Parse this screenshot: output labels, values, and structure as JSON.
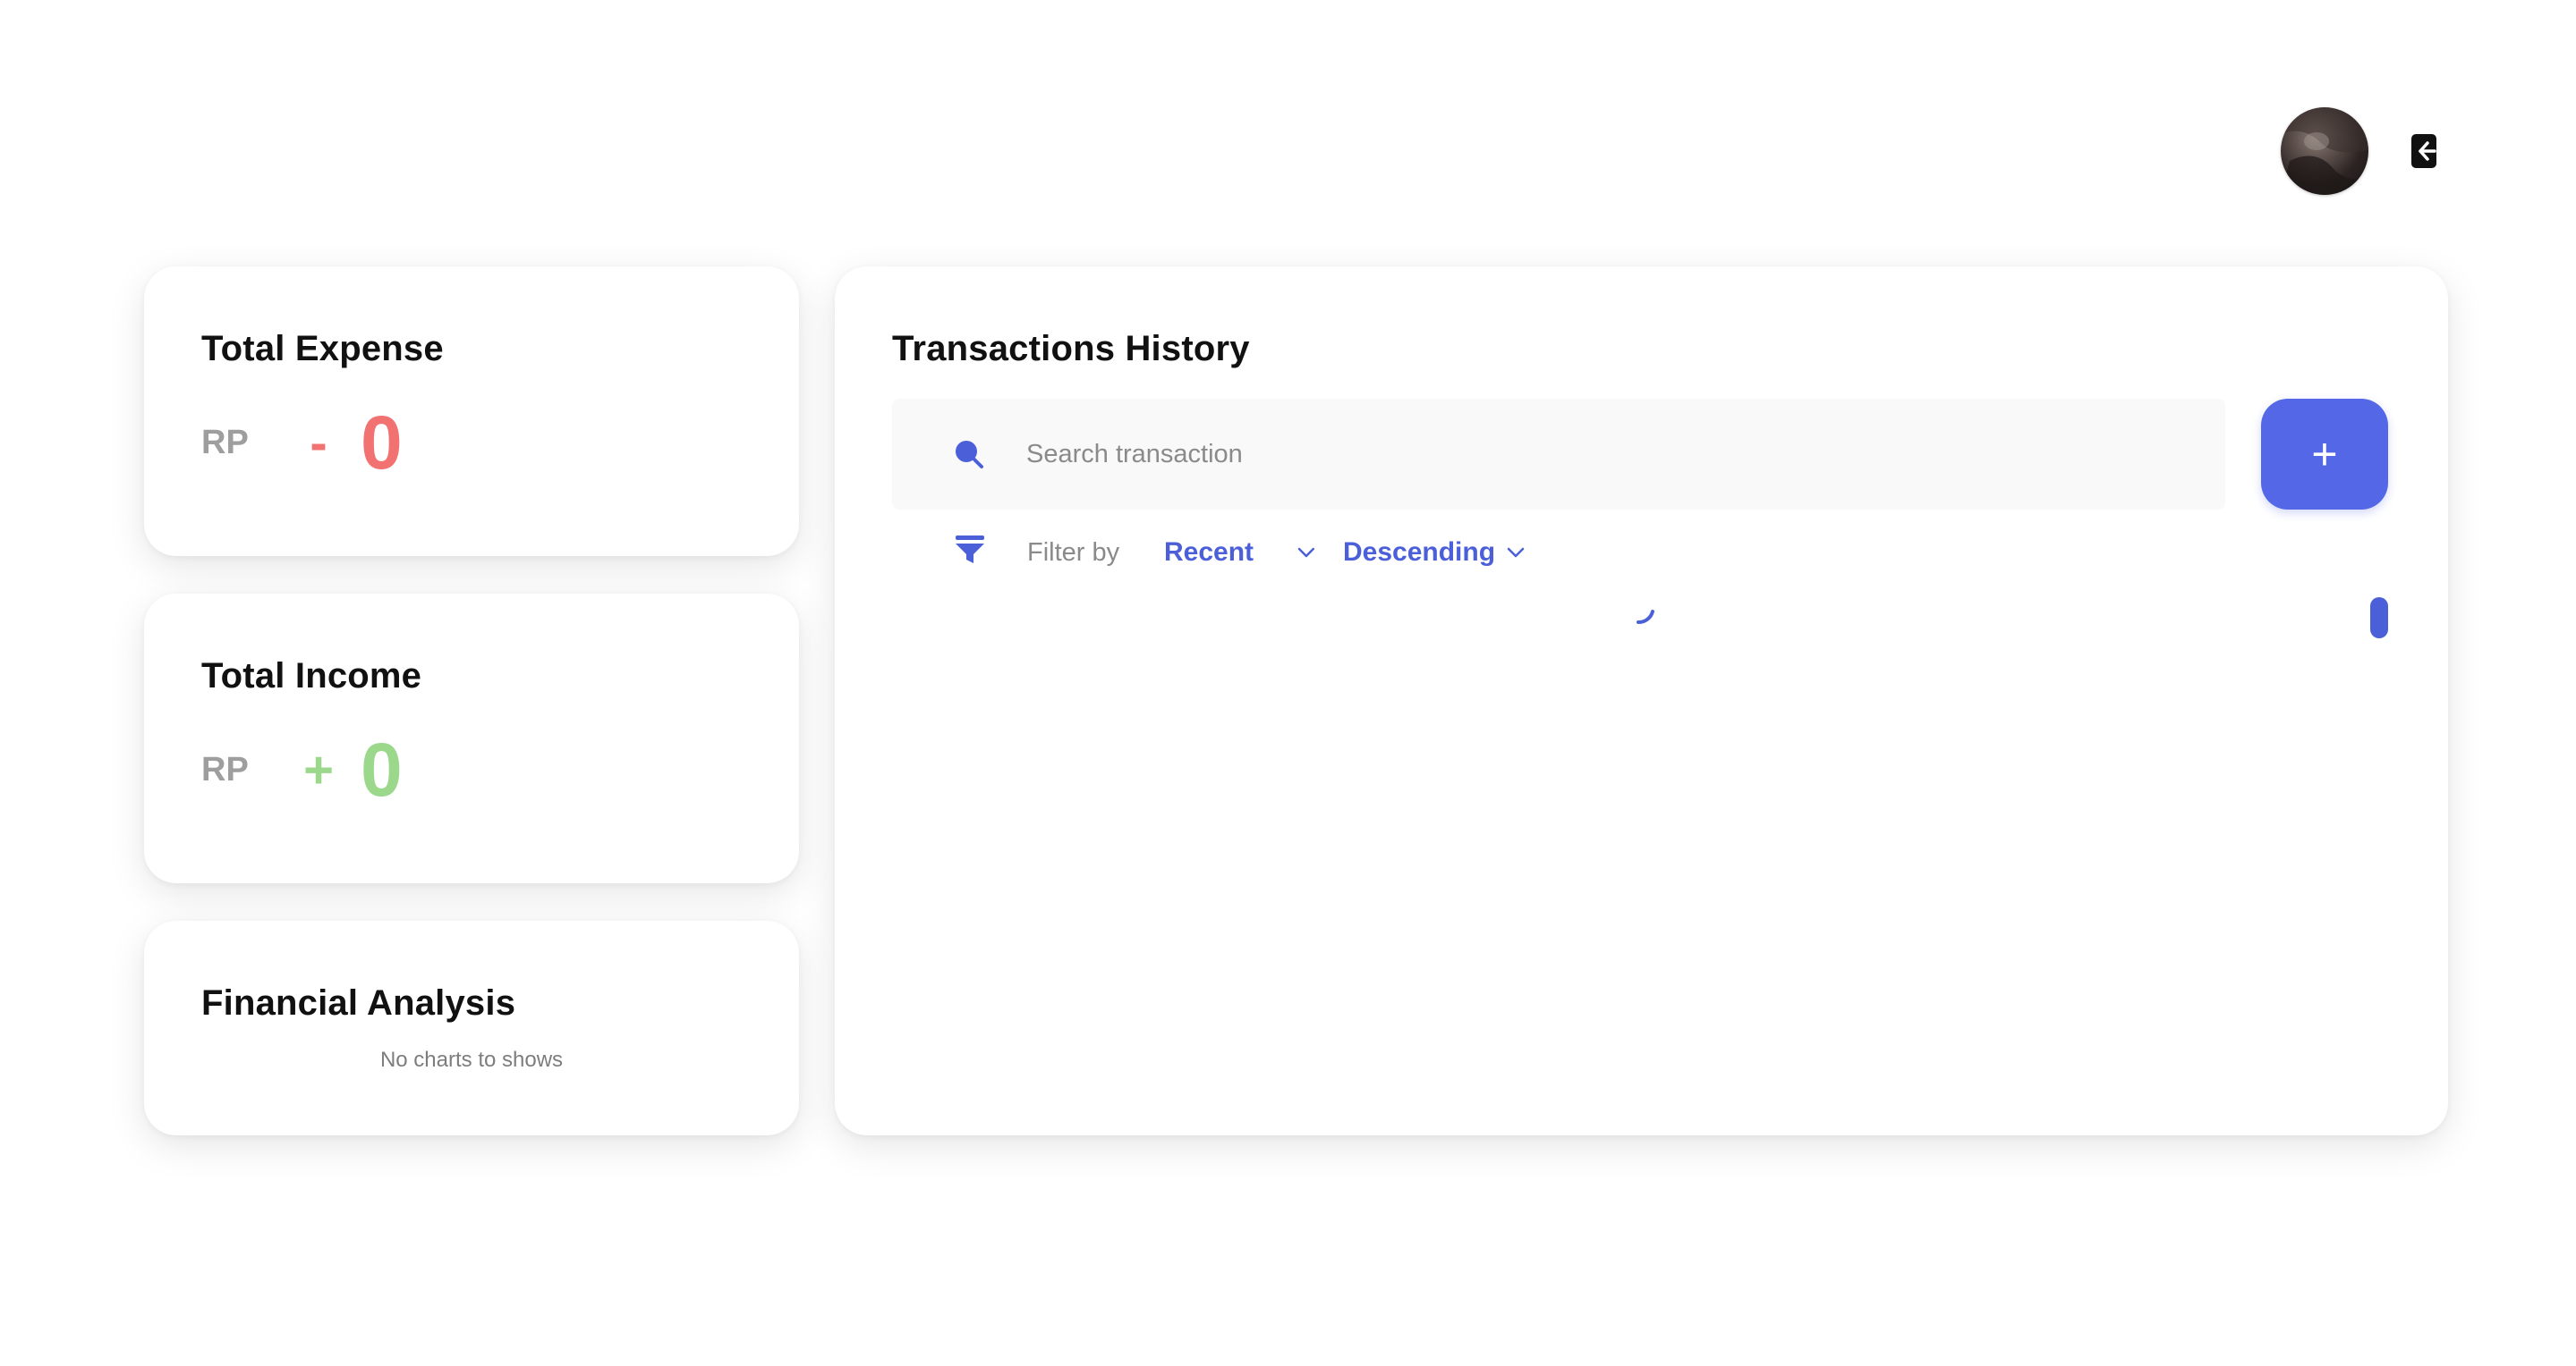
{
  "header": {
    "avatar_icon": "user-avatar",
    "logout_icon": "logout-icon"
  },
  "expense": {
    "title": "Total Expense",
    "currency": "RP",
    "sign": "-",
    "value": "0",
    "color": "#f27272"
  },
  "income": {
    "title": "Total Income",
    "currency": "RP",
    "sign": "+",
    "value": "0",
    "color": "#9bd88c"
  },
  "analysis": {
    "title": "Financial Analysis",
    "empty_text": "No charts to shows"
  },
  "history": {
    "title": "Transactions History",
    "search_placeholder": "Search transaction",
    "search_value": "",
    "add_label": "+",
    "filter_label": "Filter by",
    "filter_value": "Recent",
    "order_value": "Descending",
    "loading": true
  },
  "colors": {
    "accent": "#5468e7",
    "accent_text": "#4b5fd9",
    "expense": "#f27272",
    "income": "#9bd88c"
  }
}
